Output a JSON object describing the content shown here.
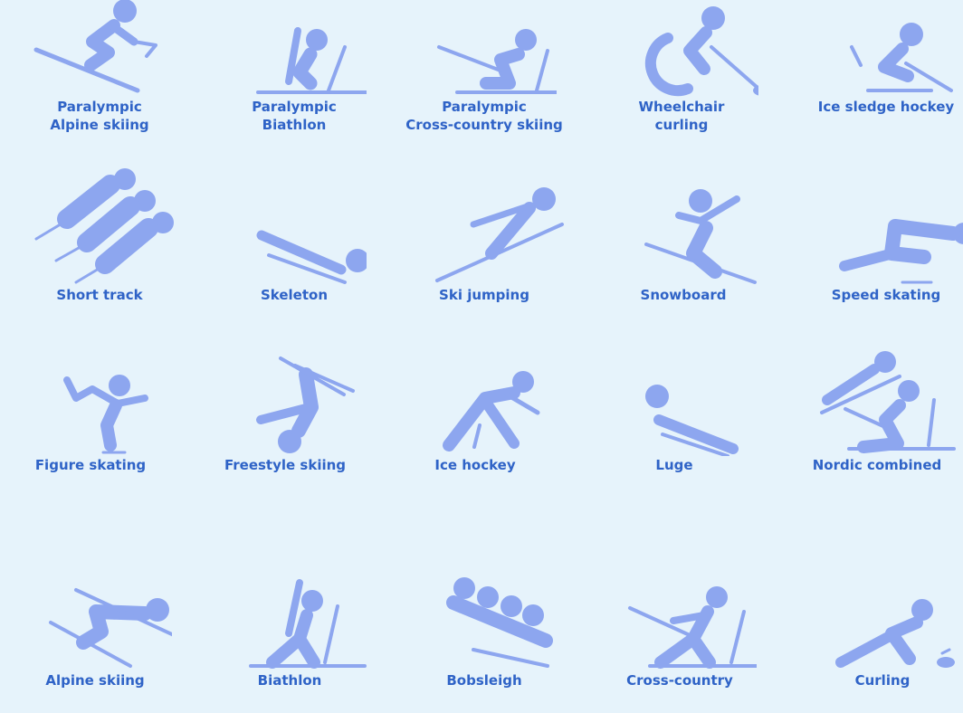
{
  "pictograms": [
    {
      "lines": [
        "Paralympic",
        "Alpine skiing"
      ],
      "icon": "paralympic-alpine-skiing-icon"
    },
    {
      "lines": [
        "Paralympic",
        "Biathlon"
      ],
      "icon": "paralympic-biathlon-icon"
    },
    {
      "lines": [
        "Paralympic",
        "Cross-country skiing"
      ],
      "icon": "paralympic-cross-country-icon"
    },
    {
      "lines": [
        "Wheelchair",
        "curling"
      ],
      "icon": "wheelchair-curling-icon"
    },
    {
      "lines": [
        "Ice sledge hockey"
      ],
      "icon": "ice-sledge-hockey-icon"
    },
    {
      "lines": [
        "Short track"
      ],
      "icon": "short-track-icon"
    },
    {
      "lines": [
        "Skeleton"
      ],
      "icon": "skeleton-icon"
    },
    {
      "lines": [
        "Ski jumping"
      ],
      "icon": "ski-jumping-icon"
    },
    {
      "lines": [
        "Snowboard"
      ],
      "icon": "snowboard-icon"
    },
    {
      "lines": [
        "Speed skating"
      ],
      "icon": "speed-skating-icon"
    },
    {
      "lines": [
        "Figure skating"
      ],
      "icon": "figure-skating-icon"
    },
    {
      "lines": [
        "Freestyle skiing"
      ],
      "icon": "freestyle-skiing-icon"
    },
    {
      "lines": [
        "Ice hockey"
      ],
      "icon": "ice-hockey-icon"
    },
    {
      "lines": [
        "Luge"
      ],
      "icon": "luge-icon"
    },
    {
      "lines": [
        "Nordic combined"
      ],
      "icon": "nordic-combined-icon"
    },
    {
      "lines": [
        "Alpine skiing"
      ],
      "icon": "alpine-skiing-icon"
    },
    {
      "lines": [
        "Biathlon"
      ],
      "icon": "biathlon-icon"
    },
    {
      "lines": [
        "Bobsleigh"
      ],
      "icon": "bobsleigh-icon"
    },
    {
      "lines": [
        "Cross-country"
      ],
      "icon": "cross-country-icon"
    },
    {
      "lines": [
        "Curling"
      ],
      "icon": "curling-icon"
    }
  ],
  "colors": {
    "background": "#e6f3fb",
    "icon": "#8da6ef",
    "label": "#2f63c7"
  }
}
